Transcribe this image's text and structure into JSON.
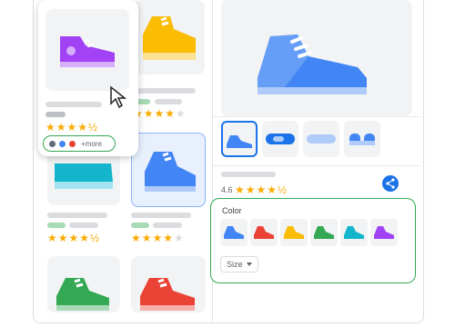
{
  "product_grid": {
    "cards": [
      {
        "id": "purple",
        "rating": "★★★★★",
        "stars_filled": 4.5
      },
      {
        "id": "yellow",
        "stars_filled": 4
      },
      {
        "id": "teal",
        "stars_filled": 4.5
      },
      {
        "id": "blue-selected",
        "stars_filled": 4
      },
      {
        "id": "green"
      },
      {
        "id": "red"
      }
    ],
    "hover_card": {
      "more_label": "+more",
      "swatch_colors": [
        "#5f6b7a",
        "#4285f4",
        "#ea4335"
      ]
    }
  },
  "detail": {
    "rating_value": "4.6",
    "stars_filled": 4.5,
    "thumbnails": [
      "side-view",
      "top-view",
      "sole-view",
      "back-view"
    ],
    "color_section": {
      "label": "Color",
      "swatches": [
        "#4285f4",
        "#ea4335",
        "#fbbc04",
        "#34a853",
        "#12b5cb",
        "#a142f4"
      ],
      "size_label": "Size"
    }
  },
  "colors": {
    "accent": "#1a73e8",
    "highlight_green": "#34a853",
    "star": "#f9ab00"
  }
}
